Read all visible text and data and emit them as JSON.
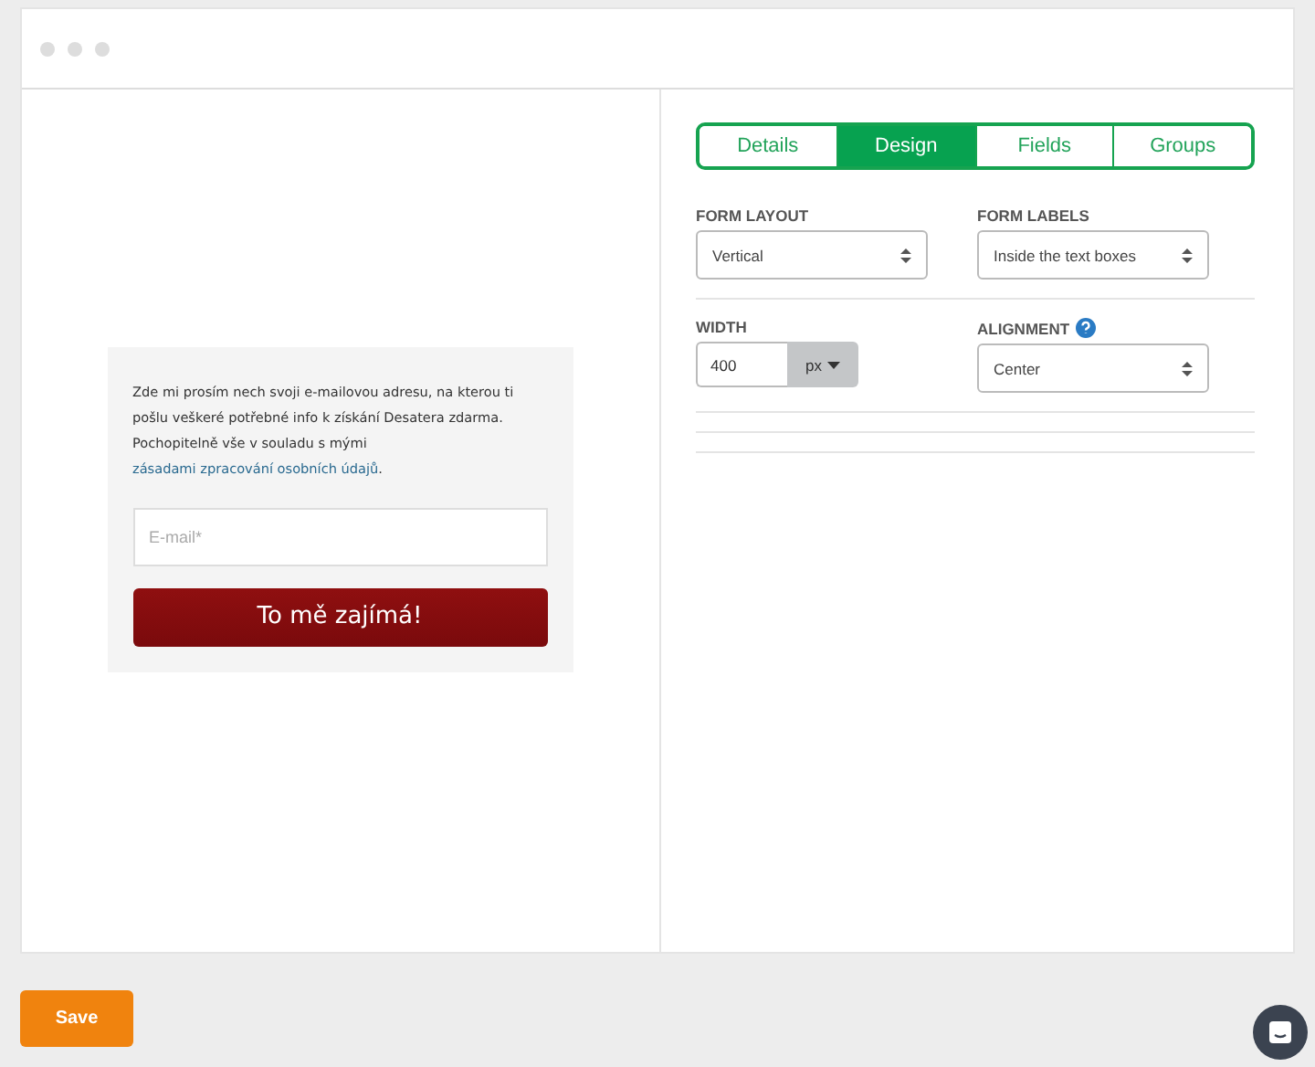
{
  "preview": {
    "intro": "Zde mi prosím nech svoji e-mailovou adresu, na kterou ti pošlu veškeré potřebné info k získání Desatera zdarma. Pochopitelně vše v souladu s mými ",
    "link": "zásadami zpracování osobních údajů",
    "intro_end": ".",
    "email_placeholder": "E-mail*",
    "submit": "To mě zajímá!"
  },
  "tabs": [
    {
      "label": "Details",
      "selected": false
    },
    {
      "label": "Design",
      "selected": true
    },
    {
      "label": "Fields",
      "selected": false
    },
    {
      "label": "Groups",
      "selected": false
    }
  ],
  "settings": [
    [
      {
        "kind": "select",
        "label": "FORM LAYOUT",
        "value": "Vertical"
      },
      {
        "kind": "select",
        "label": "FORM LABELS",
        "value": "Inside the text boxes"
      }
    ],
    [
      {
        "kind": "number",
        "label": "WIDTH",
        "value": "400",
        "unit": "px"
      },
      {
        "kind": "select",
        "label": "ALIGNMENT",
        "value": "Center",
        "help": true
      }
    ]
  ],
  "save": "Save"
}
